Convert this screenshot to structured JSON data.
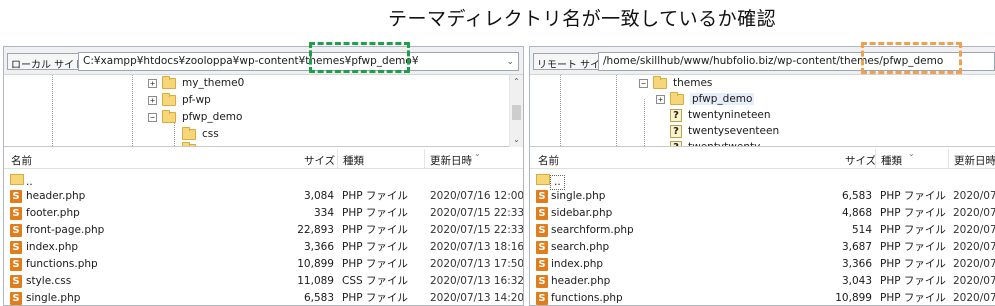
{
  "annotation": {
    "title": "テーマディレクトリ名が一致しているか確認"
  },
  "colors": {
    "highlight_local": "#1aa149",
    "highlight_remote": "#f0a04f",
    "php_icon": "#e17d1b",
    "folder": "#f7d67a"
  },
  "local": {
    "label": "ローカル サイト:",
    "path": "C:¥xampp¥htdocs¥zooloppa¥wp-content¥themes¥pfwp_demo¥",
    "tree": [
      {
        "name": "my_theme0",
        "expander": "+"
      },
      {
        "name": "pf-wp",
        "expander": "+"
      },
      {
        "name": "pfwp_demo",
        "expander": "−"
      },
      {
        "name": "css",
        "expander": ""
      }
    ],
    "columns": {
      "name": "名前",
      "size": "サイズ",
      "type": "種類",
      "modified": "更新日時"
    },
    "files": [
      {
        "name": "..",
        "size": "",
        "type": "",
        "date": ""
      },
      {
        "name": "header.php",
        "size": "3,084",
        "type": "PHP ファイル",
        "date": "2020/07/16 12:00"
      },
      {
        "name": "footer.php",
        "size": "334",
        "type": "PHP ファイル",
        "date": "2020/07/15 22:33"
      },
      {
        "name": "front-page.php",
        "size": "22,893",
        "type": "PHP ファイル",
        "date": "2020/07/15 22:33"
      },
      {
        "name": "index.php",
        "size": "3,366",
        "type": "PHP ファイル",
        "date": "2020/07/13 18:16"
      },
      {
        "name": "functions.php",
        "size": "10,899",
        "type": "PHP ファイル",
        "date": "2020/07/13 17:50"
      },
      {
        "name": "style.css",
        "size": "11,089",
        "type": "CSS ファイル",
        "date": "2020/07/13 16:32"
      },
      {
        "name": "single.php",
        "size": "6,583",
        "type": "PHP ファイル",
        "date": "2020/07/13 14:20"
      }
    ]
  },
  "remote": {
    "label": "リモート サイト:",
    "path": "/home/skillhub/www/hubfolio.biz/wp-content/themes/pfwp_demo",
    "tree": [
      {
        "name": "themes",
        "expander": "−",
        "icon": "folder"
      },
      {
        "name": "pfwp_demo",
        "expander": "+",
        "icon": "folder"
      },
      {
        "name": "twentynineteen",
        "expander": "",
        "icon": "question"
      },
      {
        "name": "twentyseventeen",
        "expander": "",
        "icon": "question"
      },
      {
        "name": "twentytwenty",
        "expander": "",
        "icon": "question"
      }
    ],
    "columns": {
      "name": "名前",
      "size": "サイズ",
      "type": "種類",
      "modified": "更新日時"
    },
    "files": [
      {
        "name": "..",
        "size": "",
        "type": "",
        "date": ""
      },
      {
        "name": "single.php",
        "size": "6,583",
        "type": "PHP ファイル",
        "date": "2020/07/"
      },
      {
        "name": "sidebar.php",
        "size": "4,868",
        "type": "PHP ファイル",
        "date": "2020/07/"
      },
      {
        "name": "searchform.php",
        "size": "514",
        "type": "PHP ファイル",
        "date": "2020/07/"
      },
      {
        "name": "search.php",
        "size": "3,687",
        "type": "PHP ファイル",
        "date": "2020/07/"
      },
      {
        "name": "index.php",
        "size": "3,366",
        "type": "PHP ファイル",
        "date": "2020/07/"
      },
      {
        "name": "header.php",
        "size": "3,043",
        "type": "PHP ファイル",
        "date": "2020/07/"
      },
      {
        "name": "functions.php",
        "size": "10,899",
        "type": "PHP ファイル",
        "date": "2020/07/"
      }
    ]
  }
}
